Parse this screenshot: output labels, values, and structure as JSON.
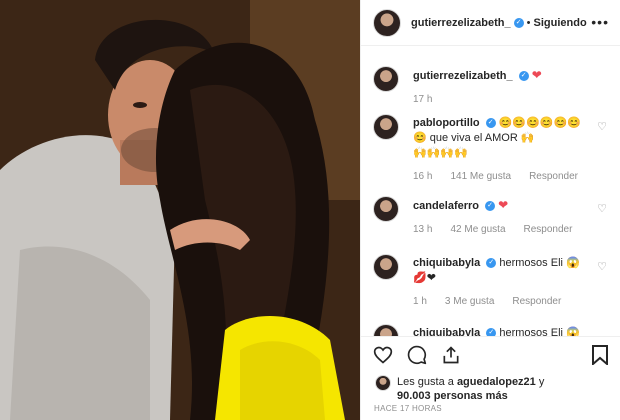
{
  "header": {
    "username": "gutierrezelizabeth_",
    "separator": "•",
    "follow_label": "Siguiendo",
    "more_icon": "more-horizontal-icon"
  },
  "comments": [
    {
      "username": "gutierrezelizabeth_",
      "text": "",
      "emoji": "❤",
      "time": "17 h",
      "likes": "",
      "reply": ""
    },
    {
      "username": "pabloportillo",
      "text": "😊😊😊😊😊😊😊 que viva el AMOR 🙌",
      "emoji_line2": "🙌🙌🙌🙌",
      "time": "16 h",
      "likes": "141 Me gusta",
      "reply": "Responder"
    },
    {
      "username": "candelaferro",
      "text": "",
      "emoji": "❤",
      "time": "13 h",
      "likes": "42 Me gusta",
      "reply": "Responder"
    },
    {
      "username": "chiquibabyla",
      "text": "hermosos Eli 😱",
      "emoji_line2": "💋❤",
      "time": "1 h",
      "likes": "3 Me gusta",
      "reply": "Responder"
    },
    {
      "username": "chiquibabyla",
      "text": "hermosos Eli 😱"
    }
  ],
  "footer": {
    "liked_prefix": "Les gusta a",
    "liked_user": "aguedalopez21",
    "liked_middle": "y",
    "liked_count": "90.003 personas más",
    "timestamp": "HACE 17 HORAS"
  },
  "colors": {
    "verified": "#3897f0",
    "heart": "#ed4956",
    "meta_grey": "#8e8e8e",
    "photo_top": "#f5e600"
  }
}
